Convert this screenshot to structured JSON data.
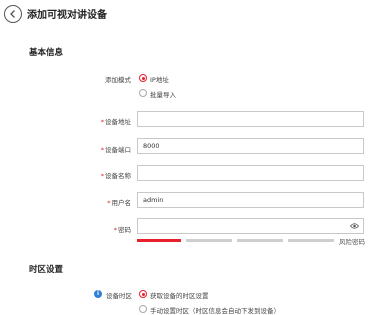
{
  "header": {
    "title": "添加可视对讲设备"
  },
  "basic_info": {
    "section_title": "基本信息",
    "add_mode": {
      "label": "添加模式",
      "options": [
        "IP地址",
        "批量导入"
      ],
      "selected": "IP地址"
    },
    "device_address": {
      "label": "设备地址",
      "value": ""
    },
    "device_port": {
      "label": "设备端口",
      "value": "8000"
    },
    "device_name": {
      "label": "设备名称",
      "value": ""
    },
    "username": {
      "label": "用户名",
      "value": "admin"
    },
    "password": {
      "label": "密码",
      "value": ""
    },
    "password_strength": {
      "label": "风险密码",
      "level": 1,
      "segments": 4
    }
  },
  "timezone": {
    "section_title": "时区设置",
    "device_timezone": {
      "label": "设备时区",
      "options": [
        "获取设备的时区设置",
        "手动设置时区（时区信息会自动下发到设备）"
      ],
      "selected": "获取设备的时区设置"
    }
  },
  "colors": {
    "accent": "#e6212a",
    "info": "#2f7ed8",
    "border": "#c8c8c8"
  },
  "icons": {
    "back": "back-arrow-icon",
    "eye": "eye-icon",
    "info": "info-icon"
  }
}
